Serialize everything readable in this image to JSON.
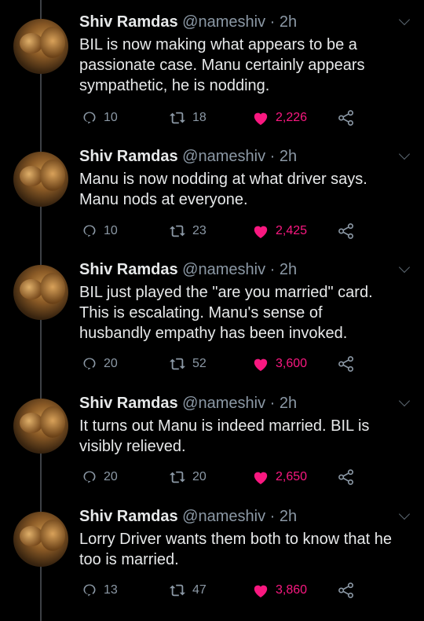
{
  "tweets": [
    {
      "name": "Shiv Ramdas",
      "handle": "@nameshiv · 2h",
      "lines": [
        "BIL is now making what appears to be a",
        "passionate case. Manu certainly appears",
        "sympathetic, he is nodding."
      ],
      "replies": "10",
      "retweets": "18",
      "likes": "2,226"
    },
    {
      "name": "Shiv Ramdas",
      "handle": "@nameshiv · 2h",
      "lines": [
        "Manu is now nodding at what driver says.",
        "Manu nods at everyone."
      ],
      "replies": "10",
      "retweets": "23",
      "likes": "2,425"
    },
    {
      "name": "Shiv Ramdas",
      "handle": "@nameshiv · 2h",
      "lines": [
        "BIL just played the \"are you married\" card.",
        "This is escalating. Manu's sense of",
        "husbandly empathy has been invoked."
      ],
      "replies": "20",
      "retweets": "52",
      "likes": "3,600"
    },
    {
      "name": "Shiv Ramdas",
      "handle": "@nameshiv · 2h",
      "lines": [
        "It turns out Manu is indeed married. BIL is",
        "visibly relieved."
      ],
      "replies": "20",
      "retweets": "20",
      "likes": "2,650"
    },
    {
      "name": "Shiv Ramdas",
      "handle": "@nameshiv · 2h",
      "lines": [
        "Lorry Driver wants them both to know that he",
        "too is married."
      ],
      "replies": "13",
      "retweets": "47",
      "likes": "3,860"
    }
  ],
  "icons": {
    "reply": "reply-icon",
    "retweet": "retweet-icon",
    "like": "heart-icon",
    "share": "share-icon",
    "menu": "chevron-down-icon"
  },
  "colors": {
    "background": "#000000",
    "text": "#e7e9ea",
    "muted": "#8b98a5",
    "like": "#f91880"
  }
}
